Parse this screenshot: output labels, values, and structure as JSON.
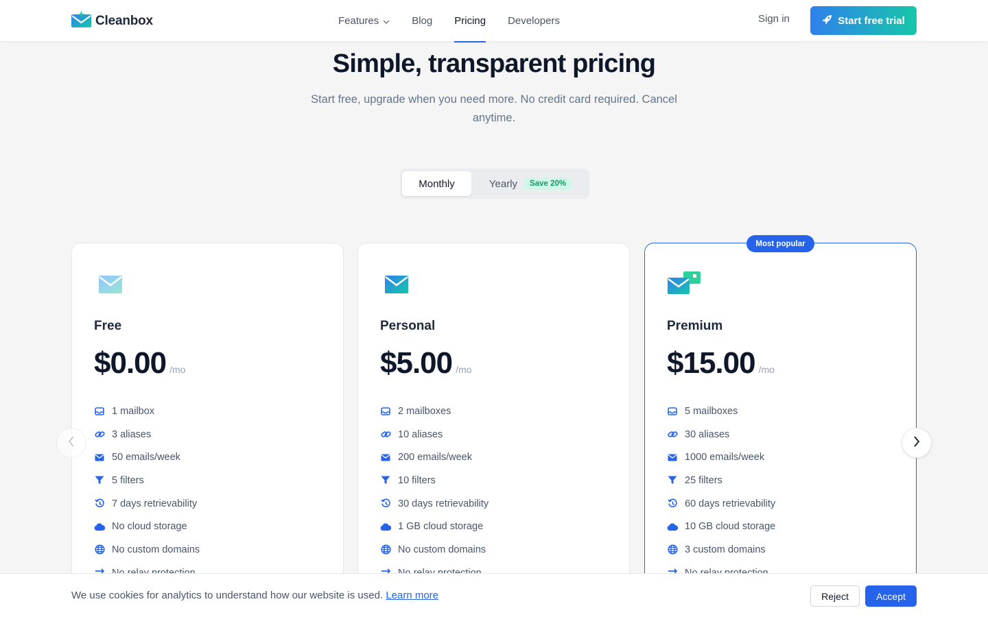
{
  "header": {
    "brand": "Cleanbox",
    "nav": [
      {
        "label": "Features",
        "has_dropdown": true,
        "active": false
      },
      {
        "label": "Blog",
        "active": false
      },
      {
        "label": "Pricing",
        "active": true
      },
      {
        "label": "Developers",
        "active": false
      }
    ],
    "sign_in": "Sign in",
    "cta": "Start free trial"
  },
  "hero": {
    "title": "Simple, transparent pricing",
    "subtitle": "Start free, upgrade when you need more. No credit card required. Cancel anytime."
  },
  "billing_toggle": {
    "monthly": "Monthly",
    "yearly": "Yearly",
    "yearly_badge": "Save 20%",
    "selected": "Monthly"
  },
  "popular_badge": "Most popular",
  "plans": [
    {
      "name": "Free",
      "price": "$0.00",
      "period": "/mo",
      "features": [
        "1 mailbox",
        "3 aliases",
        "50 emails/week",
        "5 filters",
        "7 days retrievability",
        "No cloud storage",
        "No custom domains",
        "No relay protection"
      ]
    },
    {
      "name": "Personal",
      "price": "$5.00",
      "period": "/mo",
      "features": [
        "2 mailboxes",
        "10 aliases",
        "200 emails/week",
        "10 filters",
        "30 days retrievability",
        "1 GB cloud storage",
        "No custom domains",
        "No relay protection"
      ]
    },
    {
      "name": "Premium",
      "price": "$15.00",
      "period": "/mo",
      "features": [
        "5 mailboxes",
        "30 aliases",
        "1000 emails/week",
        "25 filters",
        "60 days retrievability",
        "10 GB cloud storage",
        "3 custom domains",
        "No relay protection"
      ]
    }
  ],
  "feature_icons": [
    "inbox-icon",
    "link-icon",
    "envelope-icon",
    "filter-icon",
    "history-icon",
    "cloud-icon",
    "globe-icon",
    "relay-arrows-icon"
  ],
  "cookie": {
    "text": "We use cookies for analytics to understand how our website is used.",
    "link": "Learn more",
    "reject": "Reject",
    "accept": "Accept"
  },
  "colors": {
    "accent": "#2563eb",
    "gradient_start": "#2f80ed",
    "gradient_end": "#16c7a8",
    "badge_green": "#0f9d6b"
  }
}
